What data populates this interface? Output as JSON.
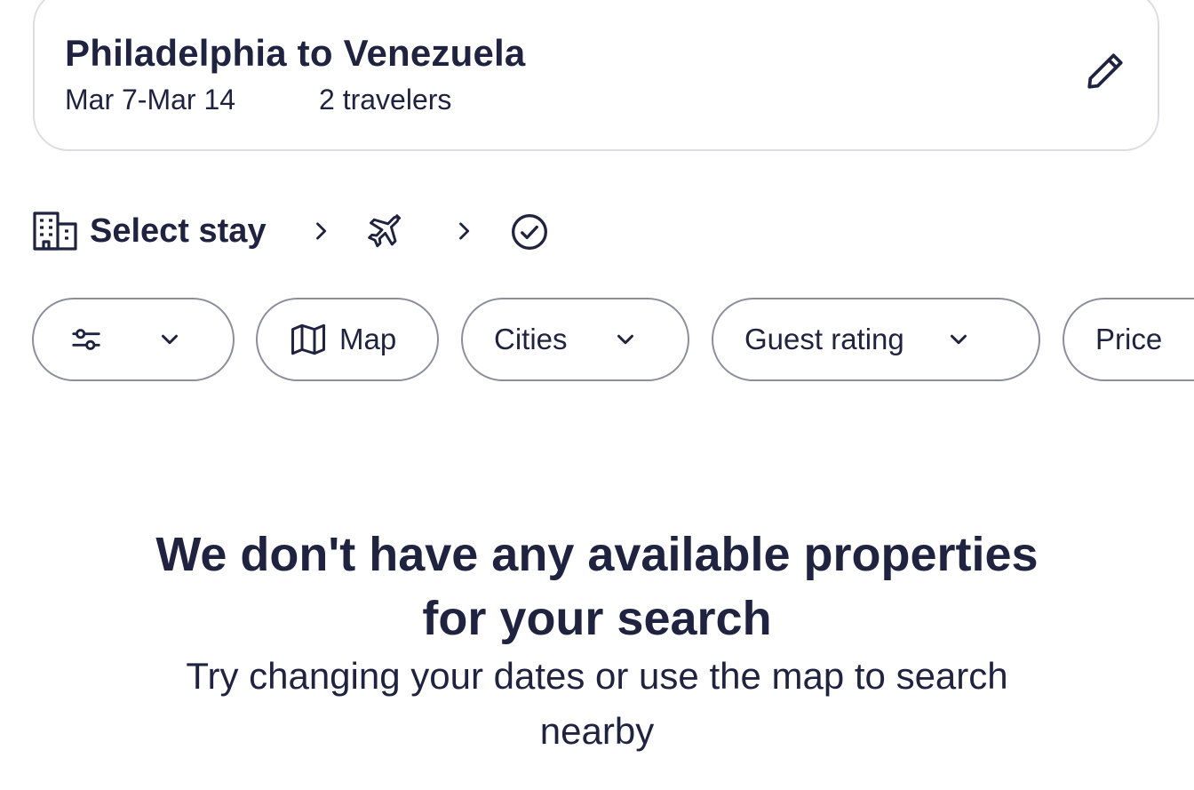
{
  "search": {
    "title": "Philadelphia to Venezuela",
    "dates": "Mar 7-Mar 14",
    "travelers": "2 travelers",
    "edit_icon": "pencil-icon"
  },
  "steps": {
    "stay_label": "Select stay",
    "stay_icon": "building-icon",
    "flight_icon": "airplane-icon",
    "confirm_icon": "check-circle-icon",
    "separator_icon": "chevron-right-icon"
  },
  "filters": {
    "settings_icon": "sliders-icon",
    "map_label": "Map",
    "cities_label": "Cities",
    "guest_rating_label": "Guest rating",
    "price_label": "Price"
  },
  "empty_state": {
    "title_line1": "We don't have any available properties",
    "title_line2": "for your search",
    "subtitle_line1": "Try changing your dates or use the map to search",
    "subtitle_line2": "nearby"
  },
  "colors": {
    "text": "#1f2340",
    "card_border": "#dcdde3",
    "pill_border": "#8c8e9c",
    "background": "#ffffff"
  }
}
